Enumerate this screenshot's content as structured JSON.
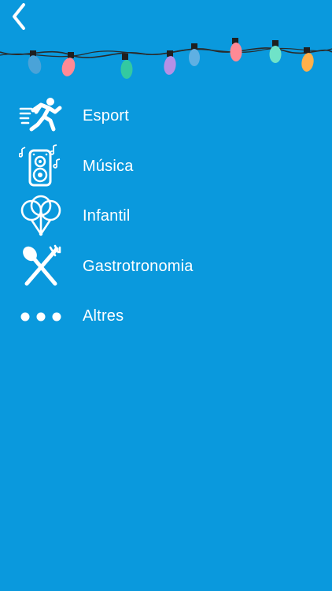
{
  "header": {
    "back_icon": "chevron-left-icon"
  },
  "decoration": {
    "bulb_colors": [
      "#4aa3d8",
      "#ff8a95",
      "#33c9a1",
      "#b590e6",
      "#5fb0e3",
      "#ff8a95",
      "#6fe3c8",
      "#ffb04a"
    ]
  },
  "menu": {
    "items": [
      {
        "label": "Esport",
        "icon": "runner-icon"
      },
      {
        "label": "Música",
        "icon": "speaker-music-icon"
      },
      {
        "label": "Infantil",
        "icon": "balloons-icon"
      },
      {
        "label": "Gastrotronomia",
        "icon": "spoon-fork-icon"
      },
      {
        "label": "Altres",
        "icon": "more-dots-icon"
      }
    ]
  }
}
